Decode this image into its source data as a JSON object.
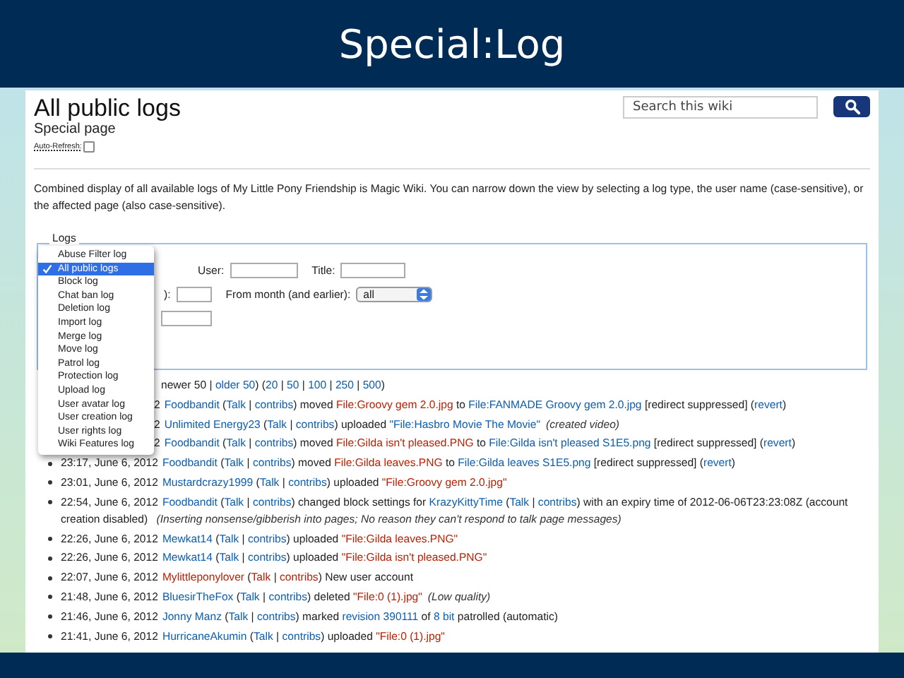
{
  "slide": {
    "title": "Special:Log"
  },
  "page": {
    "heading": "All public logs",
    "subtitle": "Special page",
    "auto_refresh": {
      "label": "Auto-Refresh:",
      "checked": false
    },
    "search": {
      "placeholder": "Search this wiki"
    },
    "description": "Combined display of all available logs of My Little Pony Friendship is Magic Wiki. You can narrow down the view by selecting a log type, the user name (case-sensitive), or the affected page (also case-sensitive).",
    "log_form": {
      "legend": "Logs",
      "user_label": "User:",
      "title_label": "Title:",
      "year_label_fragment": "):",
      "month_label": "From month (and earlier):",
      "month_value": "all"
    },
    "log_type_menu": [
      {
        "label": "Abuse Filter log",
        "selected": false
      },
      {
        "label": "All public logs",
        "selected": true
      },
      {
        "label": "Block log",
        "selected": false
      },
      {
        "label": "Chat ban log",
        "selected": false
      },
      {
        "label": "Deletion log",
        "selected": false
      },
      {
        "label": "Import log",
        "selected": false
      },
      {
        "label": "Merge log",
        "selected": false
      },
      {
        "label": "Move log",
        "selected": false
      },
      {
        "label": "Patrol log",
        "selected": false
      },
      {
        "label": "Protection log",
        "selected": false
      },
      {
        "label": "Upload log",
        "selected": false
      },
      {
        "label": "User avatar log",
        "selected": false
      },
      {
        "label": "User creation log",
        "selected": false
      },
      {
        "label": "User rights log",
        "selected": false
      },
      {
        "label": "Wiki Features log",
        "selected": false
      }
    ],
    "pagination": [
      {
        "text": "newer 50 | ",
        "kind": "plain"
      },
      {
        "text": "older 50",
        "kind": "link"
      },
      {
        "text": ") (",
        "kind": "plain"
      },
      {
        "text": "20",
        "kind": "link"
      },
      {
        "text": " | ",
        "kind": "plain"
      },
      {
        "text": "50",
        "kind": "link"
      },
      {
        "text": " | ",
        "kind": "plain"
      },
      {
        "text": "100",
        "kind": "link"
      },
      {
        "text": " | ",
        "kind": "plain"
      },
      {
        "text": "250",
        "kind": "link"
      },
      {
        "text": " | ",
        "kind": "plain"
      },
      {
        "text": "500",
        "kind": "link"
      },
      {
        "text": ")",
        "kind": "plain"
      }
    ],
    "entries": [
      {
        "timestamp": "2",
        "partial": true,
        "parts": [
          {
            "text": "Foodbandit",
            "kind": "link"
          },
          {
            "text": " (",
            "kind": "plain"
          },
          {
            "text": "Talk",
            "kind": "link"
          },
          {
            "text": " | ",
            "kind": "plain"
          },
          {
            "text": "contribs",
            "kind": "link"
          },
          {
            "text": ") moved ",
            "kind": "plain"
          },
          {
            "text": "File:Groovy gem 2.0.jpg",
            "kind": "redlink"
          },
          {
            "text": " to ",
            "kind": "plain"
          },
          {
            "text": "File:FANMADE Groovy gem 2.0.jpg",
            "kind": "link"
          },
          {
            "text": " [redirect suppressed]  (",
            "kind": "plain"
          },
          {
            "text": "revert",
            "kind": "link"
          },
          {
            "text": ")",
            "kind": "plain"
          }
        ]
      },
      {
        "timestamp": "2",
        "partial": true,
        "parts": [
          {
            "text": "Unlimited Energy23",
            "kind": "link"
          },
          {
            "text": " (",
            "kind": "plain"
          },
          {
            "text": "Talk",
            "kind": "link"
          },
          {
            "text": " | ",
            "kind": "plain"
          },
          {
            "text": "contribs",
            "kind": "link"
          },
          {
            "text": ") uploaded ",
            "kind": "plain"
          },
          {
            "text": "\"File:Hasbro Movie The Movie\"",
            "kind": "link"
          },
          {
            "text": "(created video)",
            "kind": "italic"
          }
        ]
      },
      {
        "timestamp": "2",
        "partial": true,
        "parts": [
          {
            "text": "Foodbandit",
            "kind": "link"
          },
          {
            "text": " (",
            "kind": "plain"
          },
          {
            "text": "Talk",
            "kind": "link"
          },
          {
            "text": " | ",
            "kind": "plain"
          },
          {
            "text": "contribs",
            "kind": "link"
          },
          {
            "text": ") moved ",
            "kind": "plain"
          },
          {
            "text": "File:Gilda isn't pleased.PNG",
            "kind": "redlink"
          },
          {
            "text": " to ",
            "kind": "plain"
          },
          {
            "text": "File:Gilda isn't pleased S1E5.png",
            "kind": "link"
          },
          {
            "text": " [redirect suppressed]  (",
            "kind": "plain"
          },
          {
            "text": "revert",
            "kind": "link"
          },
          {
            "text": ")",
            "kind": "plain"
          }
        ]
      },
      {
        "timestamp": "23:17, June 6, 2012",
        "partial": false,
        "parts": [
          {
            "text": "Foodbandit",
            "kind": "link"
          },
          {
            "text": " (",
            "kind": "plain"
          },
          {
            "text": "Talk",
            "kind": "link"
          },
          {
            "text": " | ",
            "kind": "plain"
          },
          {
            "text": "contribs",
            "kind": "link"
          },
          {
            "text": ") moved ",
            "kind": "plain"
          },
          {
            "text": "File:Gilda leaves.PNG",
            "kind": "redlink"
          },
          {
            "text": " to ",
            "kind": "plain"
          },
          {
            "text": "File:Gilda leaves S1E5.png",
            "kind": "link"
          },
          {
            "text": " [redirect suppressed]  (",
            "kind": "plain"
          },
          {
            "text": "revert",
            "kind": "link"
          },
          {
            "text": ")",
            "kind": "plain"
          }
        ]
      },
      {
        "timestamp": "23:01, June 6, 2012",
        "partial": false,
        "parts": [
          {
            "text": "Mustardcrazy1999",
            "kind": "link"
          },
          {
            "text": " (",
            "kind": "plain"
          },
          {
            "text": "Talk",
            "kind": "link"
          },
          {
            "text": " | ",
            "kind": "plain"
          },
          {
            "text": "contribs",
            "kind": "link"
          },
          {
            "text": ") uploaded ",
            "kind": "plain"
          },
          {
            "text": "\"File:Groovy gem 2.0.jpg\"",
            "kind": "redlink"
          }
        ]
      },
      {
        "timestamp": "22:54, June 6, 2012",
        "partial": false,
        "parts": [
          {
            "text": "Foodbandit",
            "kind": "link"
          },
          {
            "text": " (",
            "kind": "plain"
          },
          {
            "text": "Talk",
            "kind": "link"
          },
          {
            "text": " | ",
            "kind": "plain"
          },
          {
            "text": "contribs",
            "kind": "link"
          },
          {
            "text": ") changed block settings for ",
            "kind": "plain"
          },
          {
            "text": "KrazyKittyTime",
            "kind": "link"
          },
          {
            "text": " (",
            "kind": "plain"
          },
          {
            "text": "Talk",
            "kind": "link"
          },
          {
            "text": " | ",
            "kind": "plain"
          },
          {
            "text": "contribs",
            "kind": "link"
          },
          {
            "text": ") with an expiry time of 2012-06-06T23:23:08Z (account creation disabled)  ",
            "kind": "plain"
          },
          {
            "text": "(Inserting nonsense/gibberish into pages; No reason they can't respond to talk page messages)",
            "kind": "italic"
          }
        ]
      },
      {
        "timestamp": "22:26, June 6, 2012",
        "partial": false,
        "parts": [
          {
            "text": "Mewkat14",
            "kind": "link"
          },
          {
            "text": " (",
            "kind": "plain"
          },
          {
            "text": "Talk",
            "kind": "link"
          },
          {
            "text": " | ",
            "kind": "plain"
          },
          {
            "text": "contribs",
            "kind": "link"
          },
          {
            "text": ") uploaded ",
            "kind": "plain"
          },
          {
            "text": "\"File:Gilda leaves.PNG\"",
            "kind": "redlink"
          }
        ]
      },
      {
        "timestamp": "22:26, June 6, 2012",
        "partial": false,
        "parts": [
          {
            "text": "Mewkat14",
            "kind": "link"
          },
          {
            "text": " (",
            "kind": "plain"
          },
          {
            "text": "Talk",
            "kind": "link"
          },
          {
            "text": " | ",
            "kind": "plain"
          },
          {
            "text": "contribs",
            "kind": "link"
          },
          {
            "text": ") uploaded ",
            "kind": "plain"
          },
          {
            "text": "\"File:Gilda isn't pleased.PNG\"",
            "kind": "redlink"
          }
        ]
      },
      {
        "timestamp": "22:07, June 6, 2012",
        "partial": false,
        "parts": [
          {
            "text": "Mylittleponylover",
            "kind": "redlink"
          },
          {
            "text": " (",
            "kind": "plain"
          },
          {
            "text": "Talk",
            "kind": "redlink"
          },
          {
            "text": " | ",
            "kind": "plain"
          },
          {
            "text": "contribs",
            "kind": "redlink"
          },
          {
            "text": ") New user account",
            "kind": "plain"
          }
        ]
      },
      {
        "timestamp": "21:48, June 6, 2012",
        "partial": false,
        "parts": [
          {
            "text": "BluesirTheFox",
            "kind": "link"
          },
          {
            "text": " (",
            "kind": "plain"
          },
          {
            "text": "Talk",
            "kind": "link"
          },
          {
            "text": " | ",
            "kind": "plain"
          },
          {
            "text": "contribs",
            "kind": "link"
          },
          {
            "text": ") deleted ",
            "kind": "plain"
          },
          {
            "text": "\"File:0 (1).jpg\"",
            "kind": "redlink"
          },
          {
            "text": "(Low quality)",
            "kind": "italic"
          }
        ]
      },
      {
        "timestamp": "21:46, June 6, 2012",
        "partial": false,
        "parts": [
          {
            "text": "Jonny Manz",
            "kind": "link"
          },
          {
            "text": " (",
            "kind": "plain"
          },
          {
            "text": "Talk",
            "kind": "link"
          },
          {
            "text": " | ",
            "kind": "plain"
          },
          {
            "text": "contribs",
            "kind": "link"
          },
          {
            "text": ") marked ",
            "kind": "plain"
          },
          {
            "text": "revision 390111",
            "kind": "link"
          },
          {
            "text": " of ",
            "kind": "plain"
          },
          {
            "text": "8 bit",
            "kind": "link"
          },
          {
            "text": " patrolled (automatic)",
            "kind": "plain"
          }
        ]
      },
      {
        "timestamp": "21:41, June 6, 2012",
        "partial": false,
        "parts": [
          {
            "text": "HurricaneAkumin",
            "kind": "link"
          },
          {
            "text": " (",
            "kind": "plain"
          },
          {
            "text": "Talk",
            "kind": "link"
          },
          {
            "text": " | ",
            "kind": "plain"
          },
          {
            "text": "contribs",
            "kind": "link"
          },
          {
            "text": ") uploaded ",
            "kind": "plain"
          },
          {
            "text": "\"File:0 (1).jpg\"",
            "kind": "redlink"
          }
        ]
      }
    ]
  }
}
